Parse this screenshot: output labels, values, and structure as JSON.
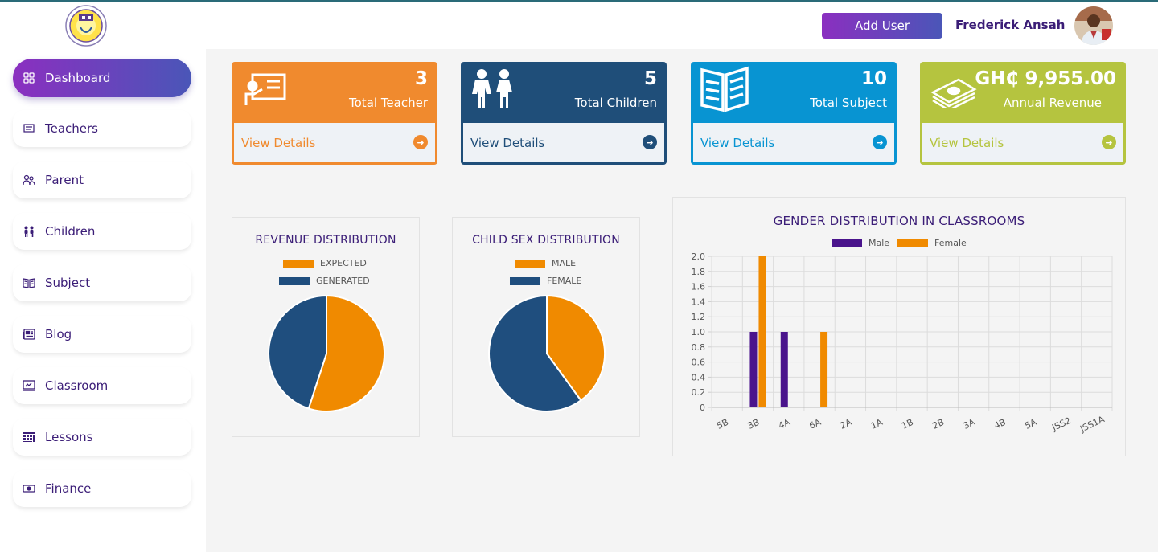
{
  "header": {
    "add_user_label": "Add User",
    "user_name": "Frederick Ansah"
  },
  "sidebar": {
    "items": [
      {
        "label": "Dashboard",
        "icon": "dashboard-icon"
      },
      {
        "label": "Teachers",
        "icon": "teachers-icon"
      },
      {
        "label": "Parent",
        "icon": "parent-icon"
      },
      {
        "label": "Children",
        "icon": "children-icon"
      },
      {
        "label": "Subject",
        "icon": "subject-icon"
      },
      {
        "label": "Blog",
        "icon": "blog-icon"
      },
      {
        "label": "Classroom",
        "icon": "classroom-icon"
      },
      {
        "label": "Lessons",
        "icon": "lessons-icon"
      },
      {
        "label": "Finance",
        "icon": "finance-icon"
      }
    ]
  },
  "cards": [
    {
      "count": "3",
      "label": "Total Teacher",
      "link": "View Details",
      "color": "#f08a2e"
    },
    {
      "count": "5",
      "label": "Total Children",
      "link": "View Details",
      "color": "#1f4e79"
    },
    {
      "count": "10",
      "label": "Total Subject",
      "link": "View Details",
      "color": "#0894d2"
    },
    {
      "count": "GH₵ 9,955.00",
      "label": "Annual Revenue",
      "link": "View Details",
      "color": "#b5c43f"
    }
  ],
  "colors": {
    "orange": "#f08a00",
    "navy": "#1f4e7e",
    "purple": "#4a148c",
    "accent_text": "#3b1d77"
  },
  "chart_data": [
    {
      "type": "pie",
      "title": "REVENUE DISTRIBUTION",
      "categories": [
        "EXPECTED",
        "GENERATED"
      ],
      "values": [
        55,
        45
      ]
    },
    {
      "type": "pie",
      "title": "CHILD SEX DISTRIBUTION",
      "categories": [
        "MALE",
        "FEMALE"
      ],
      "values": [
        2,
        3
      ]
    },
    {
      "type": "bar",
      "title": "GENDER DISTRIBUTION IN CLASSROOMS",
      "categories": [
        "5B",
        "3B",
        "4A",
        "6A",
        "2A",
        "1A",
        "1B",
        "2B",
        "3A",
        "4B",
        "5A",
        "JSS2",
        "JSS1A"
      ],
      "series": [
        {
          "name": "Male",
          "values": [
            0,
            1,
            1,
            0,
            0,
            0,
            0,
            0,
            0,
            0,
            0,
            0,
            0
          ]
        },
        {
          "name": "Female",
          "values": [
            0,
            2,
            0,
            1,
            0,
            0,
            0,
            0,
            0,
            0,
            0,
            0,
            0
          ]
        }
      ],
      "ylim": [
        0,
        2
      ],
      "yticks": [
        "0",
        "0.2",
        "0.4",
        "0.6",
        "0.8",
        "1.0",
        "1.2",
        "1.4",
        "1.6",
        "1.8",
        "2.0"
      ],
      "legend": "top",
      "grid": true
    }
  ]
}
